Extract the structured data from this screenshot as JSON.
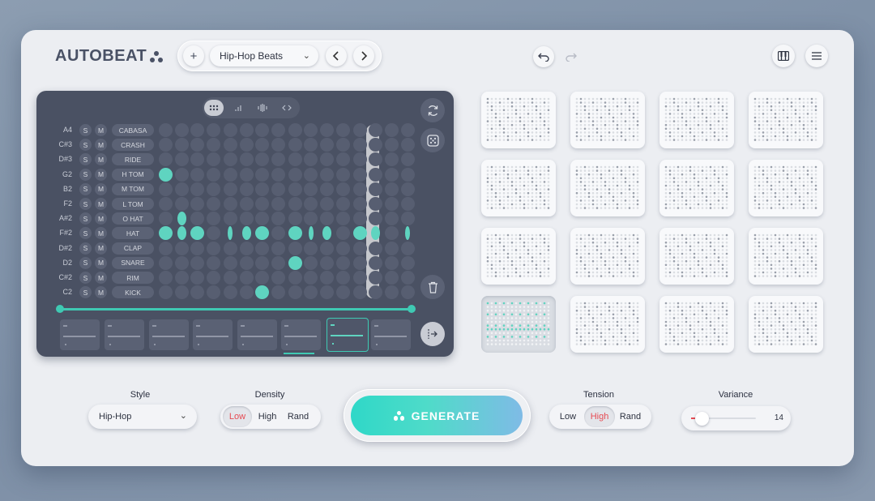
{
  "header": {
    "logo_text": "AUTOBEAT",
    "preset": "Hip-Hop Beats",
    "icons": [
      "plus-icon",
      "chevron-down-icon",
      "chevron-left-icon",
      "chevron-right-icon",
      "undo-icon",
      "redo-icon",
      "piano-icon",
      "menu-icon"
    ]
  },
  "editor": {
    "rows": [
      {
        "note": "A4",
        "name": "CABASA"
      },
      {
        "note": "C#3",
        "name": "CRASH"
      },
      {
        "note": "D#3",
        "name": "RIDE"
      },
      {
        "note": "G2",
        "name": "H TOM"
      },
      {
        "note": "B2",
        "name": "M TOM"
      },
      {
        "note": "F2",
        "name": "L TOM"
      },
      {
        "note": "A#2",
        "name": "O HAT"
      },
      {
        "note": "F#2",
        "name": "HAT"
      },
      {
        "note": "D#2",
        "name": "CLAP"
      },
      {
        "note": "D2",
        "name": "SNARE"
      },
      {
        "note": "C#2",
        "name": "RIM"
      },
      {
        "note": "C2",
        "name": "KICK"
      }
    ],
    "solo_label": "S",
    "mute_label": "M",
    "steps": 16,
    "active_cells": [
      [
        3,
        0
      ],
      [
        6,
        1
      ],
      [
        7,
        0
      ],
      [
        7,
        1
      ],
      [
        7,
        2
      ],
      [
        7,
        4
      ],
      [
        7,
        5
      ],
      [
        7,
        6
      ],
      [
        7,
        8
      ],
      [
        7,
        9
      ],
      [
        7,
        10
      ],
      [
        7,
        12
      ],
      [
        7,
        13
      ],
      [
        7,
        15
      ],
      [
        9,
        8
      ],
      [
        11,
        6
      ]
    ],
    "playhead_step": 13,
    "active_bar": 6,
    "bar_count": 8,
    "view_tabs": [
      "grid-icon",
      "bars-icon",
      "wave-icon",
      "code-icon"
    ]
  },
  "patterns": {
    "count": 16,
    "selected": 12
  },
  "controls": {
    "style": {
      "label": "Style",
      "value": "Hip-Hop"
    },
    "density": {
      "label": "Density",
      "options": [
        "Low",
        "High",
        "Rand"
      ],
      "selected": "Low"
    },
    "generate_label": "GENERATE",
    "tension": {
      "label": "Tension",
      "options": [
        "Low",
        "High",
        "Rand"
      ],
      "selected": "High"
    },
    "variance": {
      "label": "Variance",
      "value": "14"
    }
  },
  "colors": {
    "accent": "#5fd4c0",
    "active_red": "#e64b53",
    "panel": "#4a5163"
  }
}
